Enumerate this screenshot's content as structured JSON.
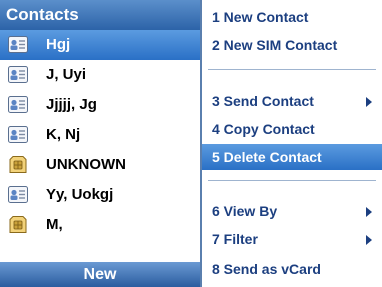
{
  "header": {
    "title": "Contacts"
  },
  "contacts": [
    {
      "name": "Hgj",
      "icon": "contact-card-icon"
    },
    {
      "name": "J, Uyi",
      "icon": "contact-card-icon"
    },
    {
      "name": "Jjjjj, Jg",
      "icon": "contact-card-icon"
    },
    {
      "name": "K, Nj",
      "icon": "contact-card-icon"
    },
    {
      "name": "UNKNOWN",
      "icon": "sim-card-icon"
    },
    {
      "name": "Yy, Uokgj",
      "icon": "contact-card-icon"
    },
    {
      "name": "M,",
      "icon": "sim-card-icon"
    }
  ],
  "selected_contact": "Hgj",
  "softkey": {
    "left_label": "New"
  },
  "menu": {
    "items": [
      {
        "label": "1 New Contact"
      },
      {
        "label": "2 New SIM Contact"
      },
      {
        "label": "3 Send Contact",
        "submenu": true
      },
      {
        "label": "4 Copy Contact"
      },
      {
        "label": "5 Delete Contact",
        "selected": true
      },
      {
        "label": "6 View By",
        "submenu": true
      },
      {
        "label": "7 Filter",
        "submenu": true
      },
      {
        "label": "8 Send as vCard"
      }
    ]
  },
  "colors": {
    "accent": "#2a70c6",
    "menu_text": "#1c3f80"
  }
}
